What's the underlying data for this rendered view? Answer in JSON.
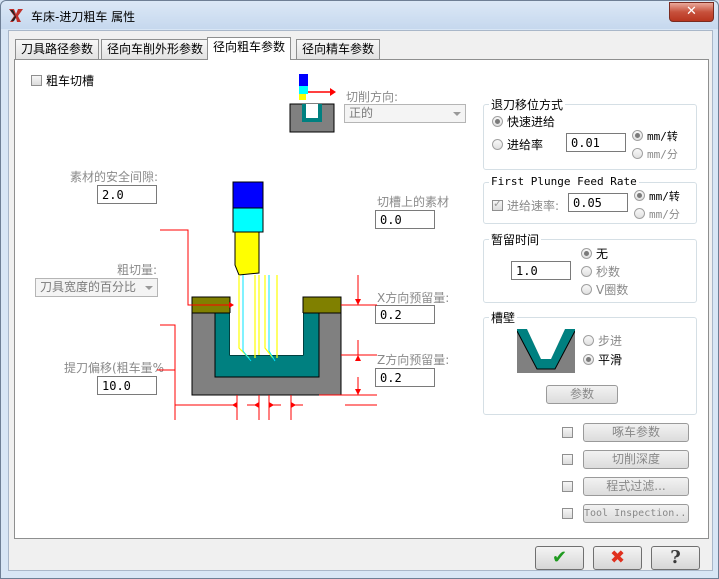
{
  "window": {
    "title": "车床-进刀粗车 属性",
    "close_glyph": "✕"
  },
  "tabs": [
    {
      "label": "刀具路径参数",
      "active": false
    },
    {
      "label": "径向车削外形参数",
      "active": false
    },
    {
      "label": "径向粗车参数",
      "active": true
    },
    {
      "label": "径向精车参数",
      "active": false
    }
  ],
  "rough_groove": {
    "label": "粗车切槽",
    "checked": false
  },
  "cut_direction": {
    "label": "切削方向:",
    "value": "正的"
  },
  "stock_clearance": {
    "label": "素材的安全间隙:",
    "value": "2.0"
  },
  "stock_on_groove": {
    "label": "切槽上的素材",
    "value": "0.0"
  },
  "rough_step": {
    "label": "粗切量:",
    "value": "刀具宽度的百分比"
  },
  "x_stock": {
    "label": "X方向预留量:",
    "value": "0.2"
  },
  "z_stock": {
    "label": "Z方向预留量:",
    "value": "0.2"
  },
  "retract_offset": {
    "label": "提刀偏移(粗车量%",
    "value": "10.0"
  },
  "retract": {
    "title": "退刀移位方式",
    "rapid_label": "快速进给",
    "feed_label": "进给率",
    "feed_value": "0.01",
    "unit_rev": "mm/转",
    "unit_min": "mm/分",
    "selected": "rapid",
    "unit_selected": "rev"
  },
  "first_plunge": {
    "title": "First Plunge Feed Rate",
    "label": "进给速率:",
    "value": "0.05",
    "checked": true,
    "unit_rev": "mm/转",
    "unit_min": "mm/分",
    "unit_selected": "rev"
  },
  "dwell": {
    "title": "暂留时间",
    "value": "1.0",
    "none_label": "无",
    "seconds_label": "秒数",
    "revs_label": "V圈数",
    "selected": "none"
  },
  "groove_wall": {
    "title": "槽壁",
    "step_label": "步进",
    "smooth_label": "平滑",
    "selected": "smooth",
    "params_button": "参数"
  },
  "side_buttons": [
    {
      "label": "啄车参数",
      "checked": false
    },
    {
      "label": "切削深度",
      "checked": false
    },
    {
      "label": "程式过滤...",
      "checked": false
    },
    {
      "label": "Tool Inspection...",
      "checked": false
    }
  ],
  "dialog_buttons": {
    "ok_glyph": "✔",
    "cancel_glyph": "✖",
    "help_glyph": "?"
  },
  "colors": {
    "tool_blue": "#0000ff",
    "tool_cyan": "#00ffff",
    "tool_yellow": "#ffff00",
    "part_gray": "#808080",
    "groove_teal": "#008080",
    "stock_olive": "#808000",
    "arrow_red": "#ff0000"
  }
}
